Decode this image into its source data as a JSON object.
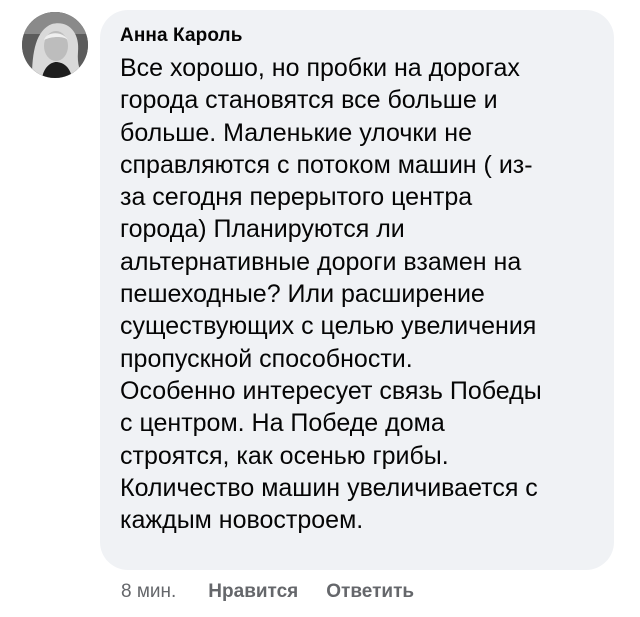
{
  "comment": {
    "author_name": "Анна Кароль",
    "text": "Все хорошо, но пробки на дорогах\nгорода становятся все больше и\nбольше. Маленькие улочки не\nсправляются с потоком машин ( из-\nза сегодня перерытого центра\nгорода) Планируются ли\nальтернативные дороги взамен на\nпешеходные? Или расширение\nсуществующих с целью увеличения\nпропускной способности.\nОсобенно интересует связь Победы\nс центром. На Победе дома\nстроятся, как осенью грибы.\nКоличество машин увеличивается с\nкаждым новостроем.",
    "timestamp": "8 мин.",
    "like_label": "Нравится",
    "reply_label": "Ответить"
  },
  "colors": {
    "bubble_background": "#f0f2f5",
    "text": "#050505",
    "meta_text": "#65676b"
  }
}
